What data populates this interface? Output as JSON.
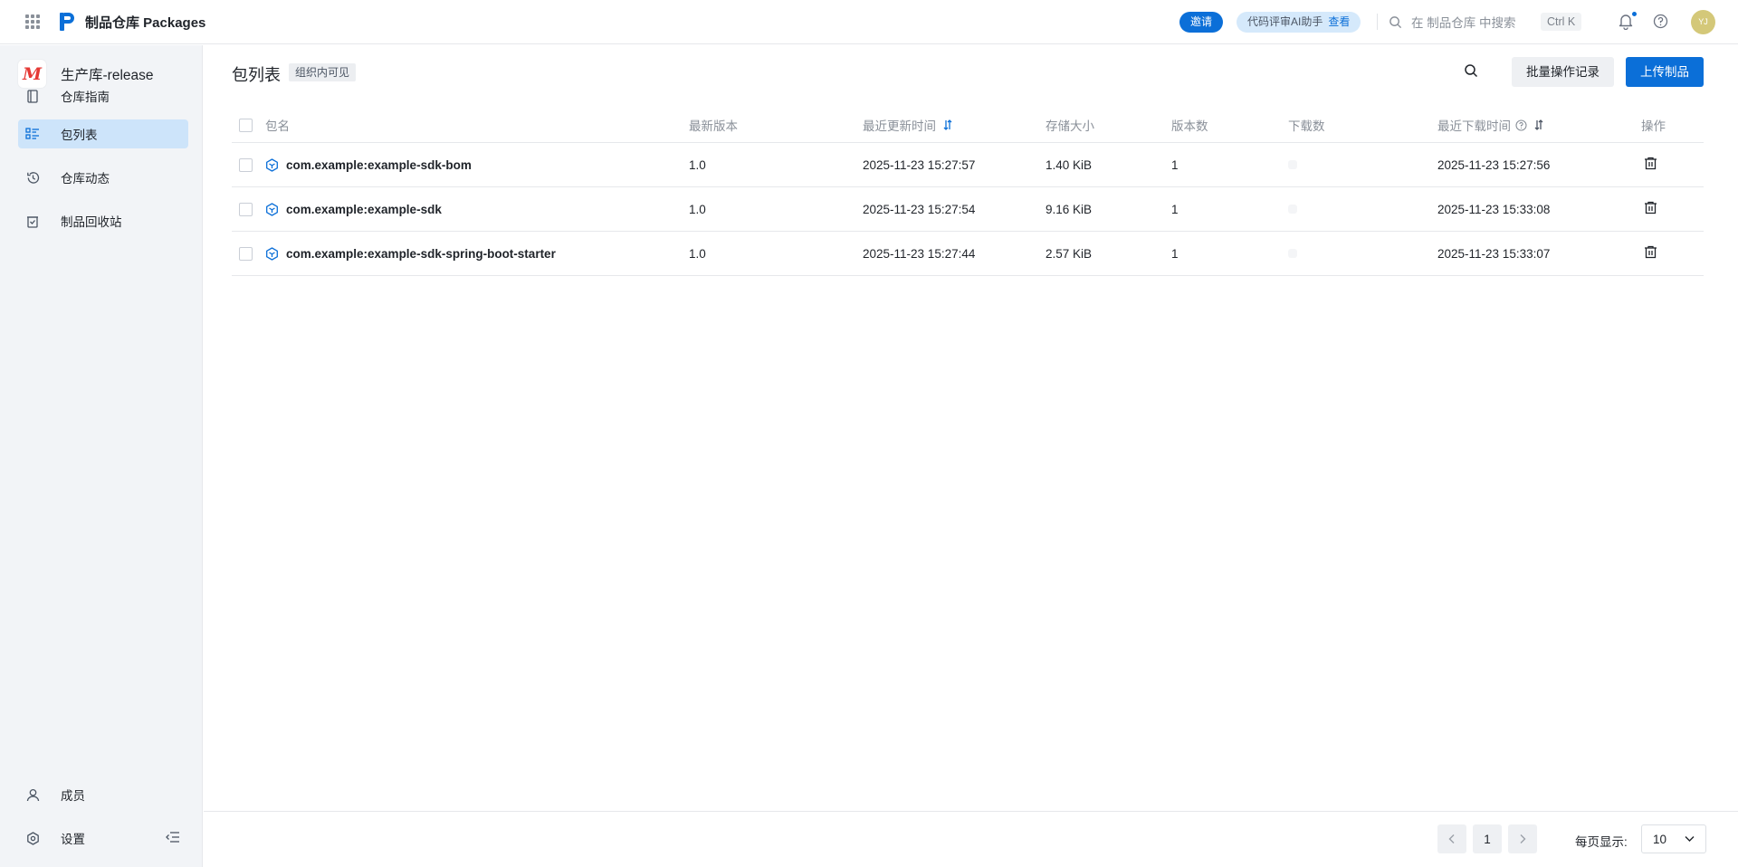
{
  "topbar": {
    "app_title": "制品仓库 Packages",
    "invite_label": "邀请",
    "ai_assistant_label": "代码评审AI助手",
    "ai_view_label": "查看",
    "search_placeholder": "在 制品仓库 中搜索",
    "shortcut": "Ctrl K",
    "avatar_initials": "YJ",
    "notification_dot": true,
    "colors": {
      "accent": "#0b6fd8",
      "ai_pill_bg": "#d5e9fb",
      "avatar_bg": "#d4c879"
    }
  },
  "sidebar": {
    "repo_logo_letter": "M",
    "repo_name": "生产库-release",
    "items": [
      {
        "label": "仓库指南",
        "icon": "book-icon",
        "active": false
      },
      {
        "label": "包列表",
        "icon": "list-icon",
        "active": true
      },
      {
        "label": "仓库动态",
        "icon": "history-icon",
        "active": false
      },
      {
        "label": "制品回收站",
        "icon": "recycle-bin-icon",
        "active": false
      }
    ],
    "bottom_items": [
      {
        "label": "成员",
        "icon": "user-icon"
      },
      {
        "label": "设置",
        "icon": "settings-icon"
      }
    ]
  },
  "main": {
    "title": "包列表",
    "scope_tag": "组织内可见",
    "batch_log_label": "批量操作记录",
    "upload_label": "上传制品"
  },
  "table": {
    "headers": {
      "name": "包名",
      "latest_version": "最新版本",
      "updated_at": "最近更新时间",
      "size": "存储大小",
      "version_count": "版本数",
      "downloads": "下载数",
      "last_download": "最近下载时间",
      "actions": "操作"
    },
    "rows": [
      {
        "name": "com.example:example-sdk-bom",
        "latest_version": "1.0",
        "updated_at": "2025-11-23 15:27:57",
        "size": "1.40 KiB",
        "version_count": "1",
        "last_download": "2025-11-23 15:27:56"
      },
      {
        "name": "com.example:example-sdk",
        "latest_version": "1.0",
        "updated_at": "2025-11-23 15:27:54",
        "size": "9.16 KiB",
        "version_count": "1",
        "last_download": "2025-11-23 15:33:08"
      },
      {
        "name": "com.example:example-sdk-spring-boot-starter",
        "latest_version": "1.0",
        "updated_at": "2025-11-23 15:27:44",
        "size": "2.57 KiB",
        "version_count": "1",
        "last_download": "2025-11-23 15:33:07"
      }
    ]
  },
  "pagination": {
    "current_page": "1",
    "per_page_label": "每页显示:",
    "per_page_value": "10"
  }
}
